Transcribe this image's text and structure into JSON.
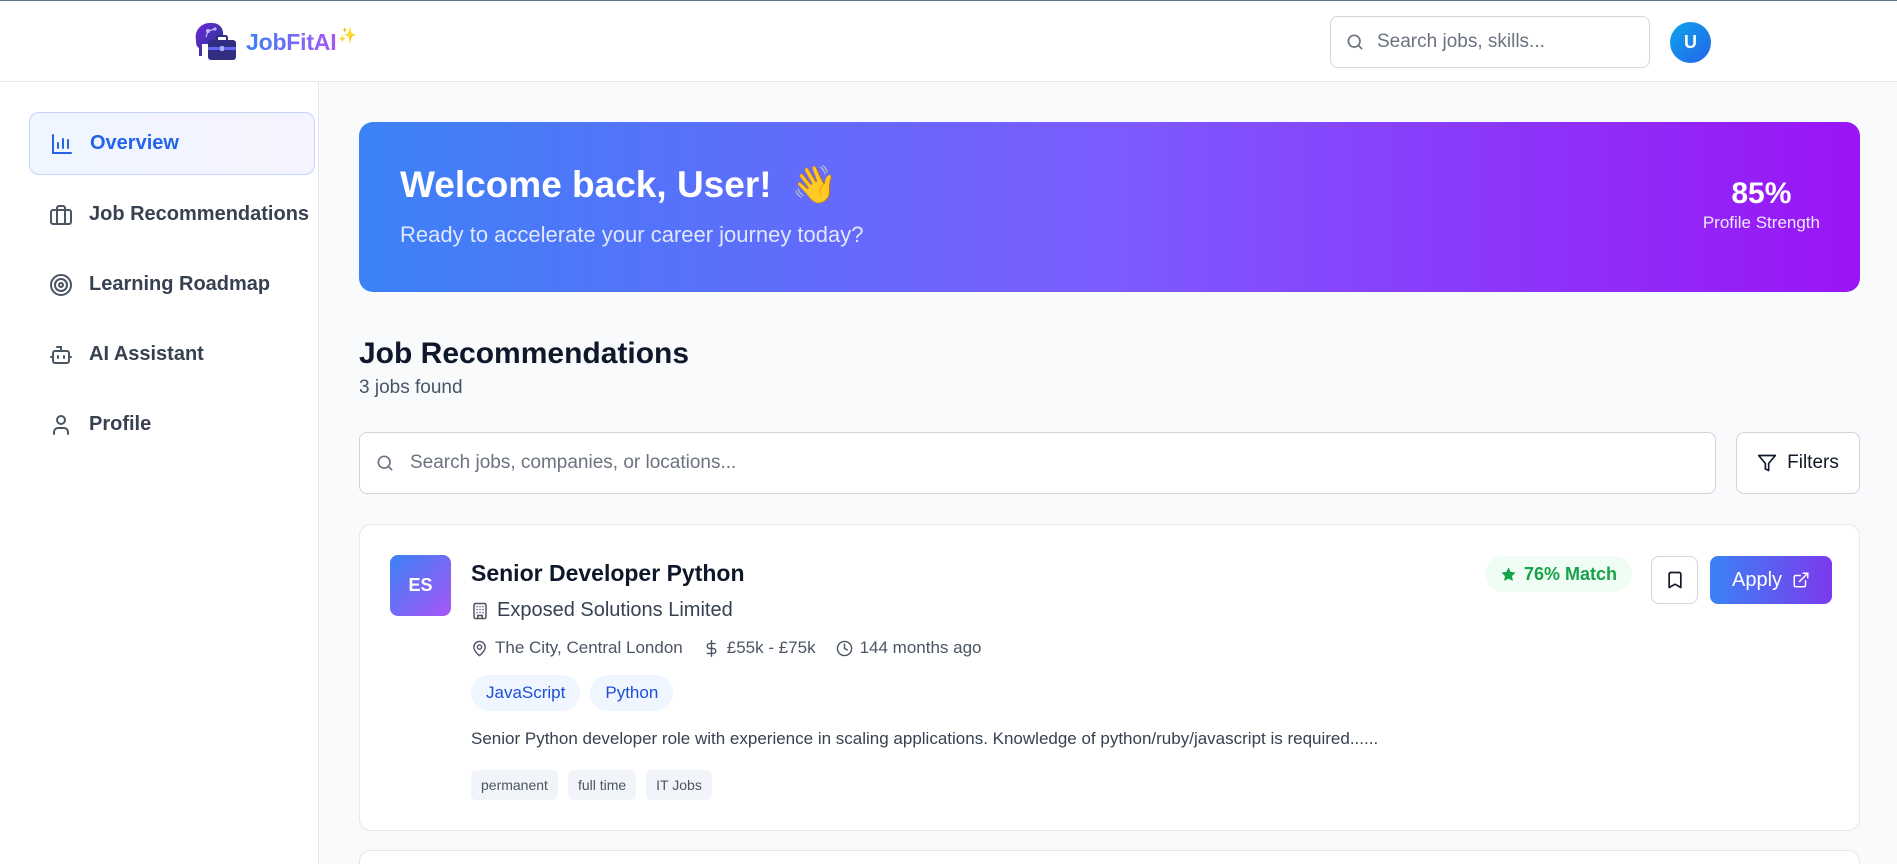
{
  "header": {
    "brand": "JobFitAI",
    "brand_spark": "✨",
    "search_placeholder": "Search jobs, skills...",
    "avatar_initial": "U"
  },
  "sidebar": {
    "items": [
      {
        "label": "Overview",
        "icon": "bar-chart-icon",
        "active": true
      },
      {
        "label": "Job Recommendations",
        "icon": "briefcase-icon",
        "active": false
      },
      {
        "label": "Learning Roadmap",
        "icon": "target-icon",
        "active": false
      },
      {
        "label": "AI Assistant",
        "icon": "bot-icon",
        "active": false
      },
      {
        "label": "Profile",
        "icon": "user-icon",
        "active": false
      }
    ]
  },
  "banner": {
    "title": "Welcome back, User!",
    "emoji": "👋",
    "subtitle": "Ready to accelerate your career journey today?",
    "strength_value": "85%",
    "strength_label": "Profile Strength"
  },
  "jobs_section": {
    "title": "Job Recommendations",
    "count": "3 jobs found",
    "search_placeholder": "Search jobs, companies, or locations...",
    "filters_label": "Filters"
  },
  "jobs": [
    {
      "initials": "ES",
      "title": "Senior Developer Python",
      "company": "Exposed Solutions Limited",
      "location": "The City, Central London",
      "salary": "£55k - £75k",
      "posted": "144 months ago",
      "skills": [
        "JavaScript",
        "Python"
      ],
      "description": "Senior Python developer role with experience in scaling applications. Knowledge of python/ruby/javascript is required......",
      "tags": [
        "permanent",
        "full time",
        "IT Jobs"
      ],
      "match": "76% Match",
      "apply_label": "Apply"
    }
  ],
  "colors": {
    "accent": "#2563eb",
    "gradient_start": "#3b82f6",
    "gradient_end": "#9a14f5",
    "match_green": "#16a34a"
  }
}
